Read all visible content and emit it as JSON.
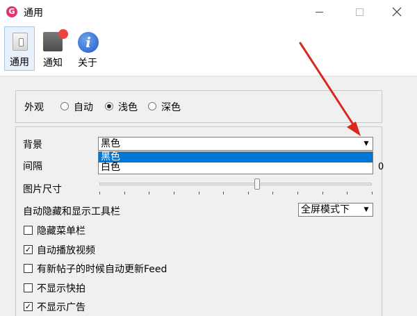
{
  "window": {
    "title": "通用",
    "app_icon_letter": "G",
    "controls": {
      "minimize": "—",
      "maximize": "☐",
      "close": "✕"
    }
  },
  "toolbar": {
    "items": [
      {
        "label": "通用",
        "icon": "switch-icon",
        "selected": true
      },
      {
        "label": "通知",
        "icon": "notification-icon"
      },
      {
        "label": "关于",
        "icon": "info-icon"
      }
    ],
    "about_icon_glyph": "i"
  },
  "appearance": {
    "label": "外观",
    "options": [
      {
        "label": "自动",
        "checked": false
      },
      {
        "label": "浅色",
        "checked": true
      },
      {
        "label": "深色",
        "checked": false
      }
    ]
  },
  "background": {
    "label": "背景",
    "value": "黑色",
    "options": [
      "黑色",
      "白色"
    ],
    "highlighted": "黑色"
  },
  "interval": {
    "label": "间隔",
    "value_partial": "0"
  },
  "image_size": {
    "label": "图片尺寸",
    "level": 0.58
  },
  "toolbar_autohide": {
    "label": "自动隐藏和显示工具栏",
    "value": "全屏模式下"
  },
  "checkboxes": [
    {
      "label": "隐藏菜单栏",
      "checked": false
    },
    {
      "label": "自动播放视频",
      "checked": true
    },
    {
      "label": "有新帖子的时候自动更新Feed",
      "checked": false
    },
    {
      "label": "不显示快拍",
      "checked": false
    },
    {
      "label": "不显示广告",
      "checked": true
    }
  ],
  "colors": {
    "selection": "#0078d7",
    "annotation_arrow": "#d9291c",
    "panel_bg": "#f0f0f0"
  }
}
